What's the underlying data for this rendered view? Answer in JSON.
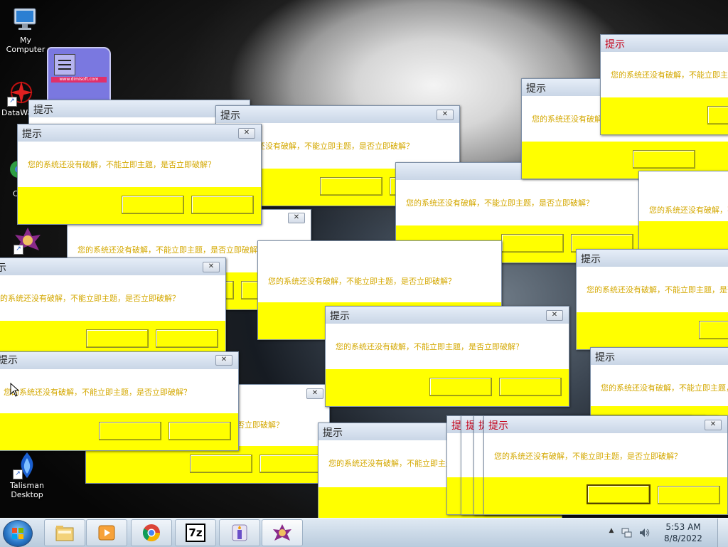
{
  "desktop_icons": [
    {
      "label": "My Computer",
      "icon": "my-computer-icon"
    },
    {
      "label": "DataWa",
      "icon": "datawave-icon"
    },
    {
      "label": "C",
      "icon": "chrome-app-icon"
    },
    {
      "label": "",
      "icon": "yugioh-app-icon"
    },
    {
      "label": "Talisman Desktop",
      "icon": "talisman-icon"
    }
  ],
  "mystery_window": {
    "banner": "www.dimisoft.com"
  },
  "dialog": {
    "title": "提示",
    "message": "您的系统还没有破解，不能立即主题，是否立即破解？",
    "close_glyph": "✕",
    "ok_label": "",
    "cancel_label": ""
  },
  "taskbar": {
    "pinned": [
      "explorer-icon",
      "media-player-icon",
      "chrome-icon",
      "7zip-icon",
      "candle-app-icon",
      "yugioh-app-icon"
    ],
    "seven_zip_text": "7z",
    "tray": {
      "time": "5:53 AM",
      "date": "8/8/2022",
      "up_arrow": "▲"
    }
  },
  "colors": {
    "dialog_band": "#ffff00",
    "dialog_text": "#d4a800",
    "active_title": "#c40018"
  }
}
